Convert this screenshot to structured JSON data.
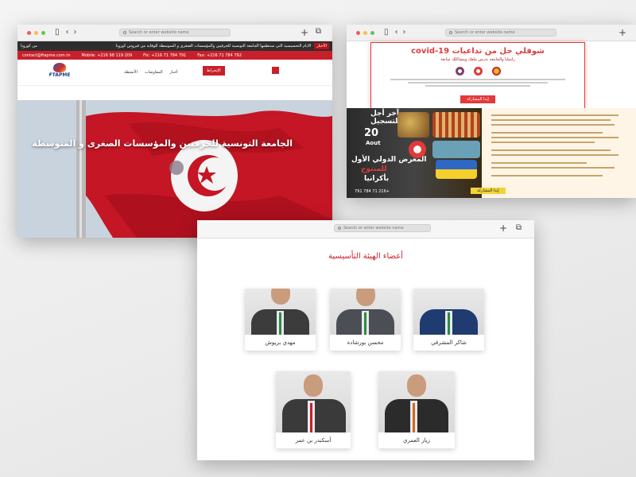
{
  "browser": {
    "url_placeholder": "Search or enter website name",
    "plus_icon": "+",
    "tabs_icon": "⧉",
    "back_icon": "‹",
    "forward_icon": "›",
    "sidebar_icon": "▯"
  },
  "site1": {
    "top_tag": "الأخبار",
    "ticker": "الأيام التحسيسية التي ستنظمها الجامعة التونسية للحرفيين والمؤسسات الصغرى و المتوسطة للوقاية من فيروس كورونا",
    "ticker_tail": "من كورونا",
    "contact": "contact@ftapme.com.tn",
    "mobile": "Mobile: +216 98 119 209",
    "fix1": "Fix: +216 71 784 791",
    "fax": "Fax: +216 71 784 792",
    "logo_text": "FTAPME",
    "menu": [
      "الأنشطة",
      "المفاوضات",
      "أخبار"
    ],
    "register": "الإنخراط",
    "hero_title": "الجامعة التونسية للحرفيين والمؤسسات الصغرى و المتوسطة"
  },
  "site2": {
    "covid_title": "شوفلي حل من تداعيات covid-19",
    "covid_sub": "راسلنا والجامعة تدرس ملفك ومشاكلك متابعة",
    "covid_btn": "إبدا المشاركة",
    "banner_line1": "آخر أجل",
    "banner_line2": "للتسجيل",
    "banner_day": "20",
    "banner_month": "Aout",
    "banner_line3": "المعرض الدولي الأول",
    "banner_line4": "للمنتوج",
    "banner_line5": "بأكرانيا",
    "phone": "+216 71 784 791",
    "yellow_btn": "إبدا المشاركة"
  },
  "site3": {
    "section_title": "أعضاء الهيئة التأسيسية",
    "members": [
      {
        "name": "شاكر المشرقي"
      },
      {
        "name": "محسن بورشادة"
      },
      {
        "name": "مهدي بريوش"
      },
      {
        "name": "زيار العمري"
      },
      {
        "name": "أسكندر بن عمر"
      }
    ]
  },
  "colors": {
    "brand_red": "#c8202b",
    "covid_red": "#e23a3a",
    "banner_yellow": "#f3d23a"
  }
}
